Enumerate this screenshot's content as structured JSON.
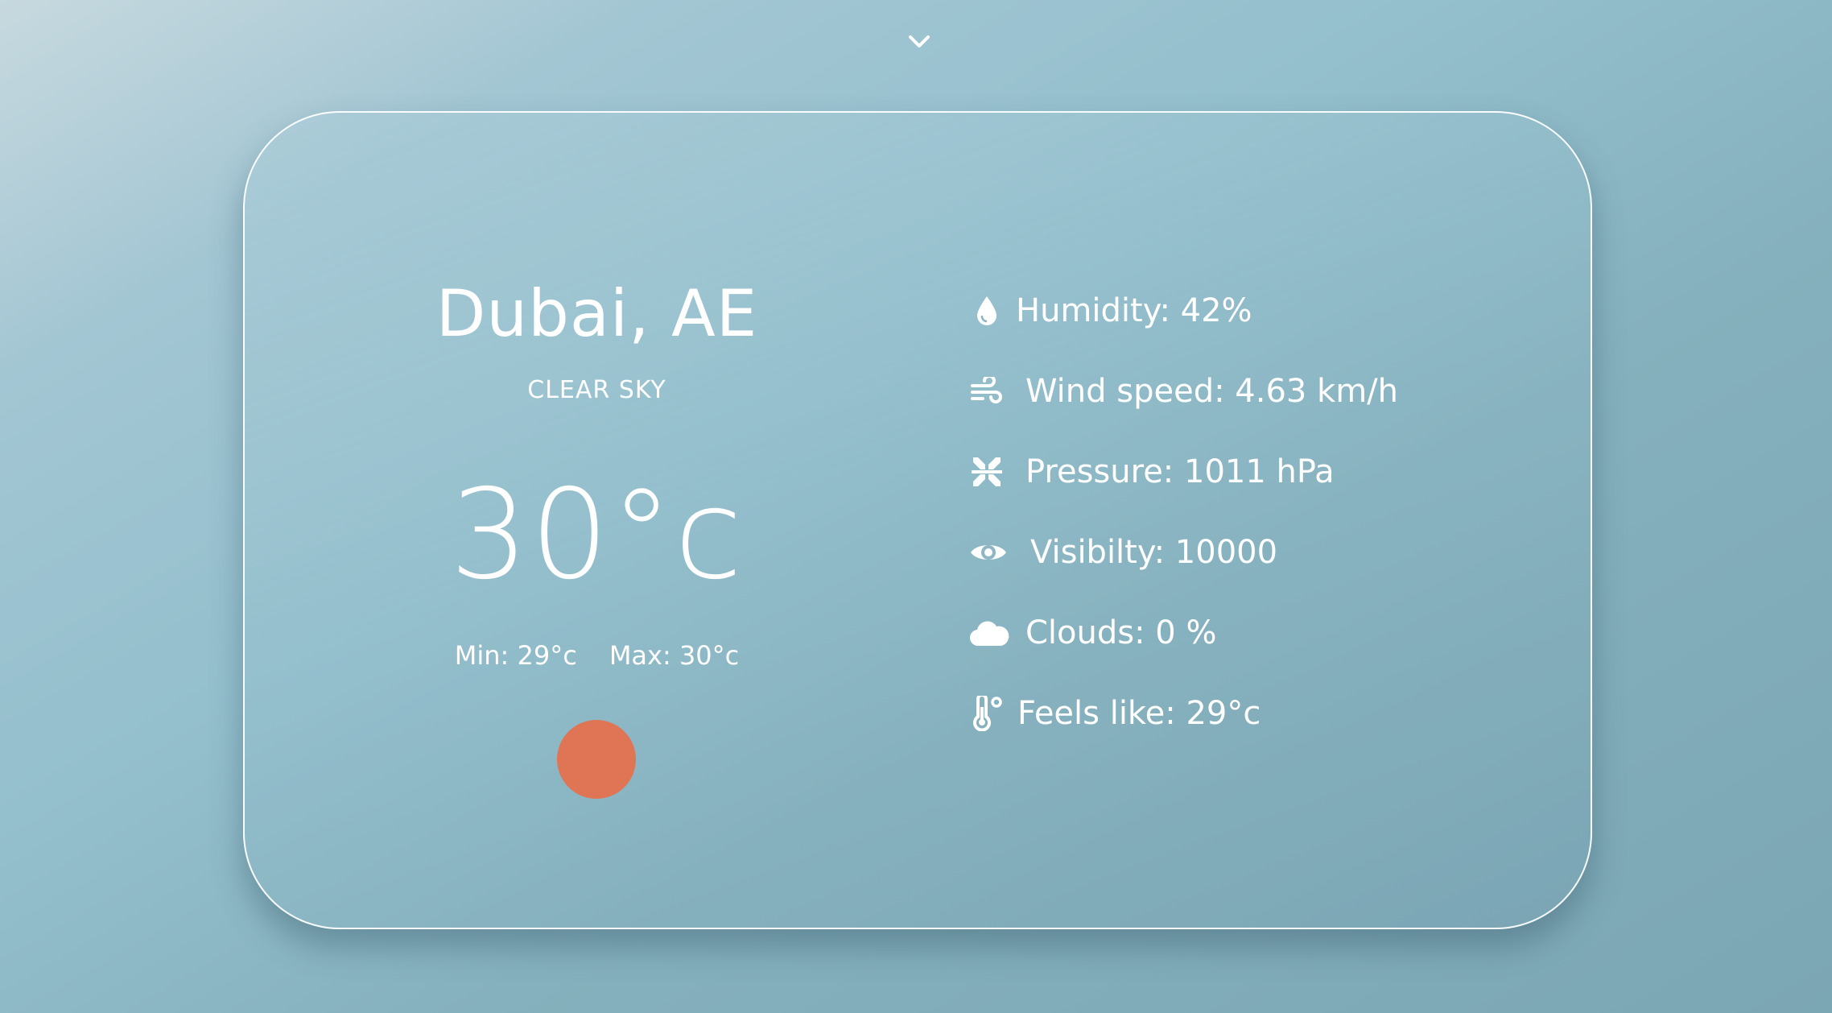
{
  "weather": {
    "city": "Dubai, AE",
    "description": "CLEAR SKY",
    "temperature": "30°c",
    "min": "Min: 29°c",
    "max": "Max: 30°c",
    "sun_color": "#e07555",
    "icon": "sun-icon"
  },
  "details": [
    {
      "icon": "water-drop-icon",
      "label": "Humidity: 42%"
    },
    {
      "icon": "wind-icon",
      "label": "Wind speed: 4.63 km/h"
    },
    {
      "icon": "compress-icon",
      "label": "Pressure: 1011 hPa"
    },
    {
      "icon": "eye-icon",
      "label": "Visibilty: 10000"
    },
    {
      "icon": "cloud-icon",
      "label": "Clouds: 0 %"
    },
    {
      "icon": "thermometer-icon",
      "label": "Feels like: 29°c"
    }
  ],
  "nav": {
    "toggle_icon": "chevron-down-icon"
  }
}
